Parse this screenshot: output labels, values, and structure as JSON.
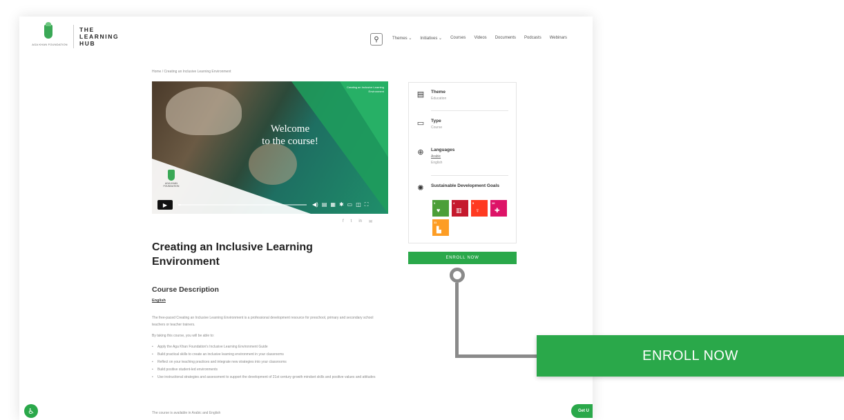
{
  "header": {
    "logo_small_text": "AGA KHAN FOUNDATION",
    "logo_line1": "THE",
    "logo_line2": "LEARNING",
    "logo_line3": "HUB",
    "nav": [
      "Themes ⌄",
      "Initiatives ⌄",
      "Courses",
      "Videos",
      "Documents",
      "Podcasts",
      "Webinars"
    ]
  },
  "breadcrumb": "Home / Creating an Inclusive Learning Environment",
  "video": {
    "welcome_line1": "Welcome",
    "welcome_line2": "to the course!",
    "corner_text": "Creating an Inclusive Learning Environment",
    "logo_text": "AGA KHAN FOUNDATION",
    "progress": 0.02
  },
  "share_icons": [
    "facebook-icon",
    "twitter-icon",
    "linkedin-icon",
    "email-icon"
  ],
  "course": {
    "title": "Creating an Inclusive Learning Environment",
    "section_title": "Course Description",
    "language_link": "English",
    "intro": "The free-paced Creating an Inclusive Learning Environment is a professional development resource for preschool, primary and secondary school teachers or teacher trainers.",
    "by_end": "By taking this course, you will be able to:",
    "bullets": [
      "Apply the Aga Khan Foundation's Inclusive Learning Environment Guide",
      "Build practical skills to create an inclusive learning environment in your classrooms",
      "Reflect on your teaching practices and integrate new strategies into your classrooms",
      "Build positive student-led environments",
      "Use instructional strategies and assessment to support the development of 21st century growth mindset skills and positive values and attitudes"
    ],
    "availability": "The course is available in Arabic and English"
  },
  "sidebar": {
    "theme_label": "Theme",
    "theme_value": "Education",
    "type_label": "Type",
    "type_value": "Course",
    "languages_label": "Languages",
    "languages_value1": "Arabic",
    "languages_value2": "English",
    "sdg_label": "Sustainable Development Goals",
    "sdgs": [
      {
        "num": "3",
        "color": "#4c9f38"
      },
      {
        "num": "4",
        "color": "#c5192d"
      },
      {
        "num": "5",
        "color": "#ff3a21"
      },
      {
        "num": "10",
        "color": "#dd1367"
      },
      {
        "num": "11",
        "color": "#fd9d24"
      }
    ]
  },
  "enroll_small": "ENROLL NOW",
  "enroll_big": "ENROLL NOW",
  "get_button": "Get U"
}
